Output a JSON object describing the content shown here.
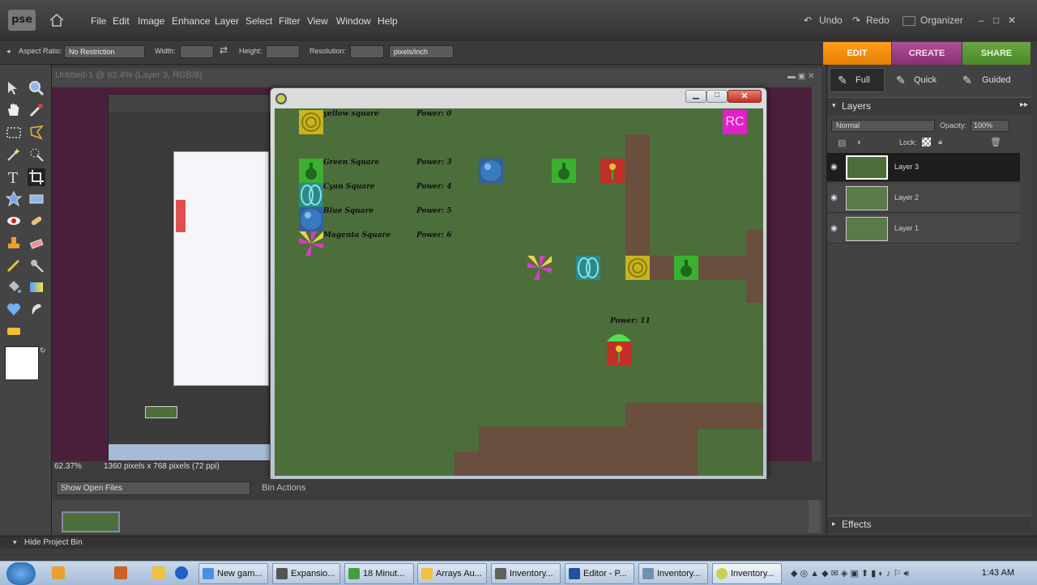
{
  "app": {
    "logo": "pse",
    "menu": [
      "File",
      "Edit",
      "Image",
      "Enhance",
      "Layer",
      "Select",
      "Filter",
      "View",
      "Window",
      "Help"
    ],
    "undo": "Undo",
    "redo": "Redo",
    "organizer": "Organizer"
  },
  "options": {
    "aspect_label": "Aspect Ratio:",
    "aspect_value": "No Restriction",
    "width_label": "Width:",
    "height_label": "Height:",
    "resolution_label": "Resolution:",
    "resolution_unit": "pixels/inch"
  },
  "mode_tabs": [
    "EDIT",
    "CREATE",
    "SHARE"
  ],
  "edit_modes": [
    "Full",
    "Quick",
    "Guided"
  ],
  "document": {
    "title": "Untitled-1 @ 62.4% (Layer 3, RGB/8)",
    "zoom": "62.37%",
    "dimensions": "1360 pixels x 768 pixels (72 ppi)"
  },
  "bin": {
    "select_value": "Show Open Files",
    "actions": "Bin Actions",
    "hide_label": "Hide Project Bin"
  },
  "layers_panel": {
    "title": "Layers",
    "blend": "Normal",
    "opacity_label": "Opacity:",
    "opacity_value": "100%",
    "lock_label": "Lock:",
    "layers": [
      "Layer 3",
      "Layer 2",
      "Layer 1"
    ],
    "effects": "Effects"
  },
  "game": {
    "legend": [
      {
        "name": "yellow square",
        "power": "Power: 0"
      },
      {
        "name": "Green Square",
        "power": "Power: 3"
      },
      {
        "name": "Cyan Square",
        "power": "Power: 4"
      },
      {
        "name": "Blue Square",
        "power": "Power: 5"
      },
      {
        "name": "Magenta Square",
        "power": "Power: 6"
      }
    ],
    "rc": "RC",
    "player_power": "Power: 11"
  },
  "taskbar": {
    "tasks": [
      "New gam...",
      "Expansio...",
      "18 Minut...",
      "Arrays Au...",
      "Inventory...",
      "Editor - P...",
      "Inventory...",
      "Inventory..."
    ],
    "clock": "1:43 AM"
  },
  "colors": {
    "edit_tab": "#f28b10",
    "create_tab": "#9c3b82",
    "share_tab": "#5a9a36",
    "grass": "#4c6e3b",
    "path": "#6a4e3e",
    "canvas_bg": "#4b1f3c"
  }
}
